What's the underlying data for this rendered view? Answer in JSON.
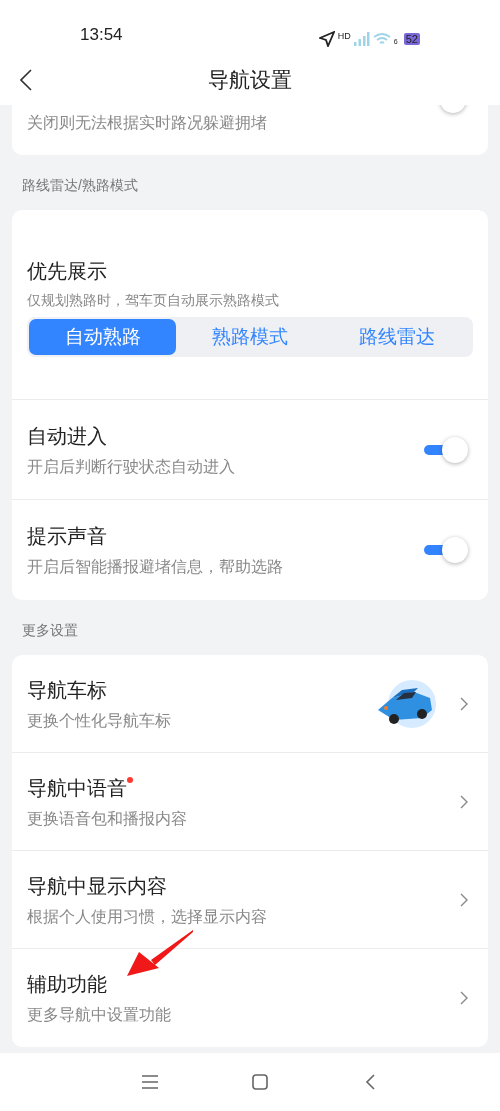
{
  "status_bar": {
    "time": "13:54",
    "network": "HD",
    "wifi": "6",
    "battery": "52"
  },
  "header": {
    "title": "导航设置"
  },
  "top_card": {
    "subtitle": "关闭则无法根据实时路况躲避拥堵"
  },
  "sections": [
    {
      "title": "路线雷达/熟路模式",
      "segment": {
        "title": "优先展示",
        "subtitle": "仅规划熟路时，驾车页自动展示熟路模式",
        "options": [
          {
            "label": "自动熟路",
            "selected": true
          },
          {
            "label": "熟路模式",
            "selected": false
          },
          {
            "label": "路线雷达",
            "selected": false
          }
        ]
      },
      "rows": [
        {
          "kind": "toggle",
          "title": "自动进入",
          "subtitle": "开启后判断行驶状态自动进入",
          "on": true
        },
        {
          "kind": "toggle",
          "title": "提示声音",
          "subtitle": "开启后智能播报避堵信息，帮助选路",
          "on": true
        }
      ]
    },
    {
      "title": "更多设置",
      "rows": [
        {
          "kind": "car",
          "title": "导航车标",
          "subtitle": "更换个性化导航车标",
          "badge": false
        },
        {
          "kind": "link",
          "title": "导航中语音",
          "subtitle": "更换语音包和播报内容",
          "badge": true
        },
        {
          "kind": "link",
          "title": "导航中显示内容",
          "subtitle": "根据个人使用习惯，选择显示内容",
          "badge": false
        },
        {
          "kind": "link",
          "title": "辅助功能",
          "subtitle": "更多导航中设置功能",
          "badge": false
        }
      ]
    }
  ]
}
